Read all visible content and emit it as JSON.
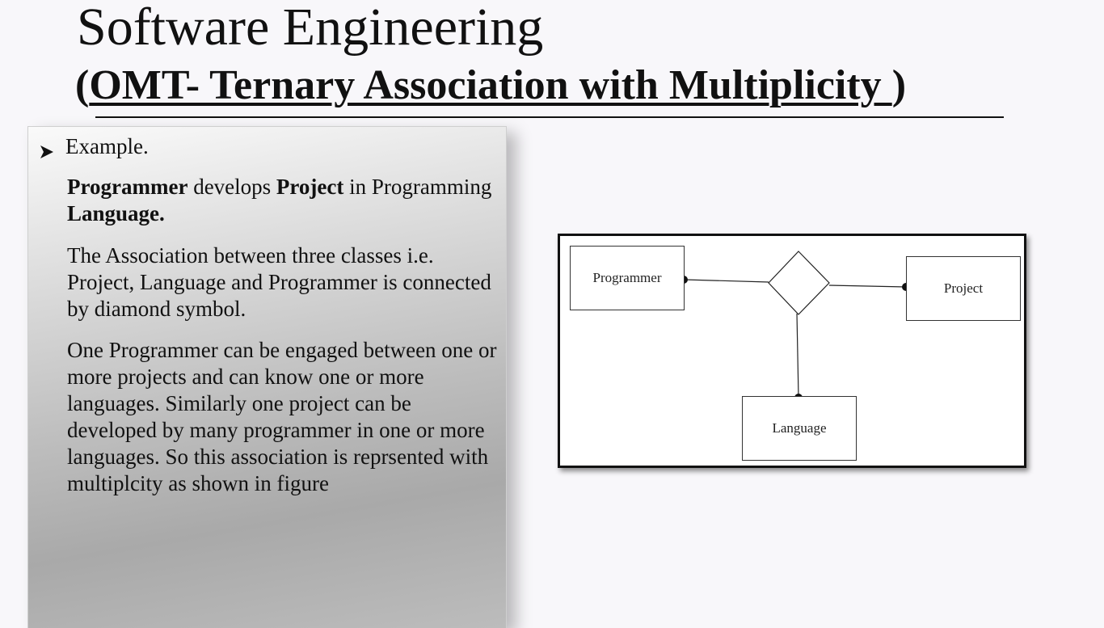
{
  "slide": {
    "title": "Software Engineering",
    "subtitle_open": "(",
    "subtitle_main": "OMT-   Ternary Association with Multiplicity ",
    "subtitle_close": ")"
  },
  "content": {
    "bullet_icon": "arrow-bullet-icon",
    "bullet_label": "Example.",
    "para1": {
      "w1": "Programmer",
      "t1": " develops ",
      "w2": "Project",
      "t2": " in Programming ",
      "w3": "Language."
    },
    "para2": "The Association between three classes i.e. Project, Language and Programmer  is connected by diamond symbol.",
    "para3": "One Programmer can be engaged between one  or more projects  and can know one or more languages. Similarly one project can be developed by many programmer in one or more languages. So this association is reprsented with multiplcity as  shown in figure"
  },
  "diagram": {
    "classes": {
      "programmer": "Programmer",
      "project": "Project",
      "language": "Language"
    }
  }
}
